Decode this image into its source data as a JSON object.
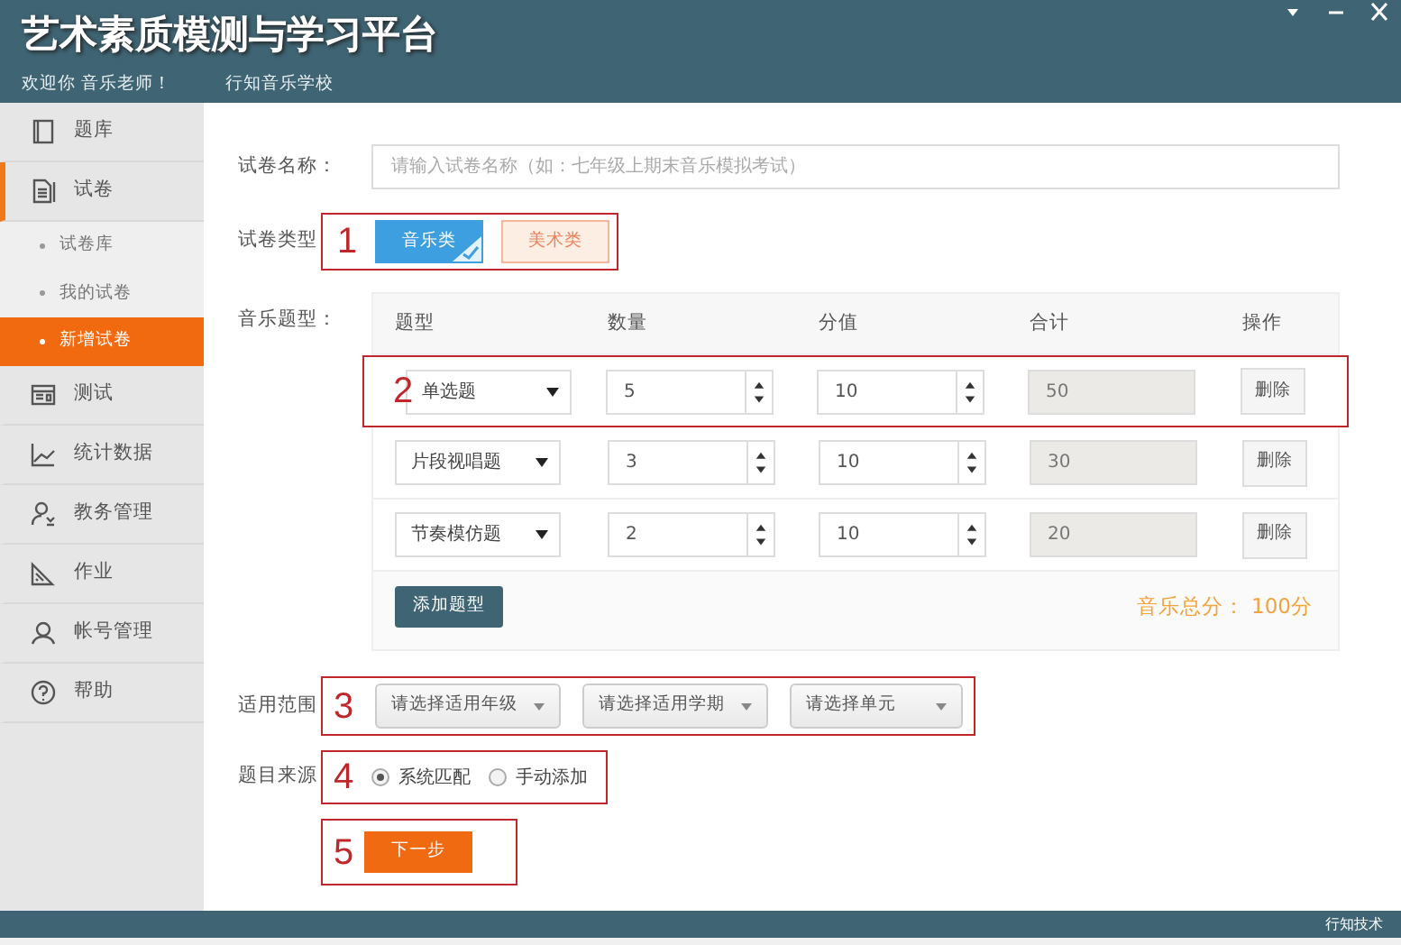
{
  "window": {
    "title": "艺术素质模测与学习平台",
    "welcome": "欢迎你 音乐老师！",
    "school": "行知音乐学校"
  },
  "sidebar": {
    "items": [
      {
        "label": "题库",
        "expanded": false
      },
      {
        "label": "试卷",
        "expanded": true,
        "children": [
          {
            "label": "试卷库",
            "selected": false
          },
          {
            "label": "我的试卷",
            "selected": false
          },
          {
            "label": "新增试卷",
            "selected": true
          }
        ]
      },
      {
        "label": "测试",
        "expanded": false
      },
      {
        "label": "统计数据",
        "expanded": false
      },
      {
        "label": "教务管理",
        "expanded": false
      },
      {
        "label": "作业",
        "expanded": false
      },
      {
        "label": "帐号管理",
        "expanded": false
      },
      {
        "label": "帮助",
        "expanded": false
      }
    ]
  },
  "form": {
    "name_field": {
      "label": "试卷名称：",
      "placeholder": "请输入试卷名称（如：七年级上期末音乐模拟考试）"
    },
    "paper_type": {
      "label": "试卷类型",
      "step": "1",
      "options": [
        {
          "label": "音乐类",
          "selected": true
        },
        {
          "label": "美术类",
          "selected": false
        }
      ]
    },
    "question_types": {
      "label": "音乐题型：",
      "columns": [
        "题型",
        "数量",
        "分值",
        "合计",
        "操作"
      ],
      "rows": [
        {
          "step": "2",
          "type": "单选题",
          "quantity": "5",
          "score": "10",
          "total": "50",
          "action": "删除"
        },
        {
          "type": "片段视唱题",
          "quantity": "3",
          "score": "10",
          "total": "30",
          "action": "删除"
        },
        {
          "type": "节奏模仿题",
          "quantity": "2",
          "score": "10",
          "total": "20",
          "action": "删除"
        }
      ],
      "add_button": "添加题型",
      "total_text": "音乐总分： 100分"
    },
    "scope": {
      "label": "适用范围",
      "step": "3",
      "selects": [
        "请选择适用年级",
        "请选择适用学期",
        "请选择单元"
      ]
    },
    "source": {
      "label": "题目来源",
      "step": "4",
      "options": [
        {
          "label": "系统匹配",
          "selected": true
        },
        {
          "label": "手动添加",
          "selected": false
        }
      ]
    },
    "next": {
      "step": "5",
      "label": "下一步"
    }
  },
  "footer": {
    "brand": "行知技术"
  }
}
